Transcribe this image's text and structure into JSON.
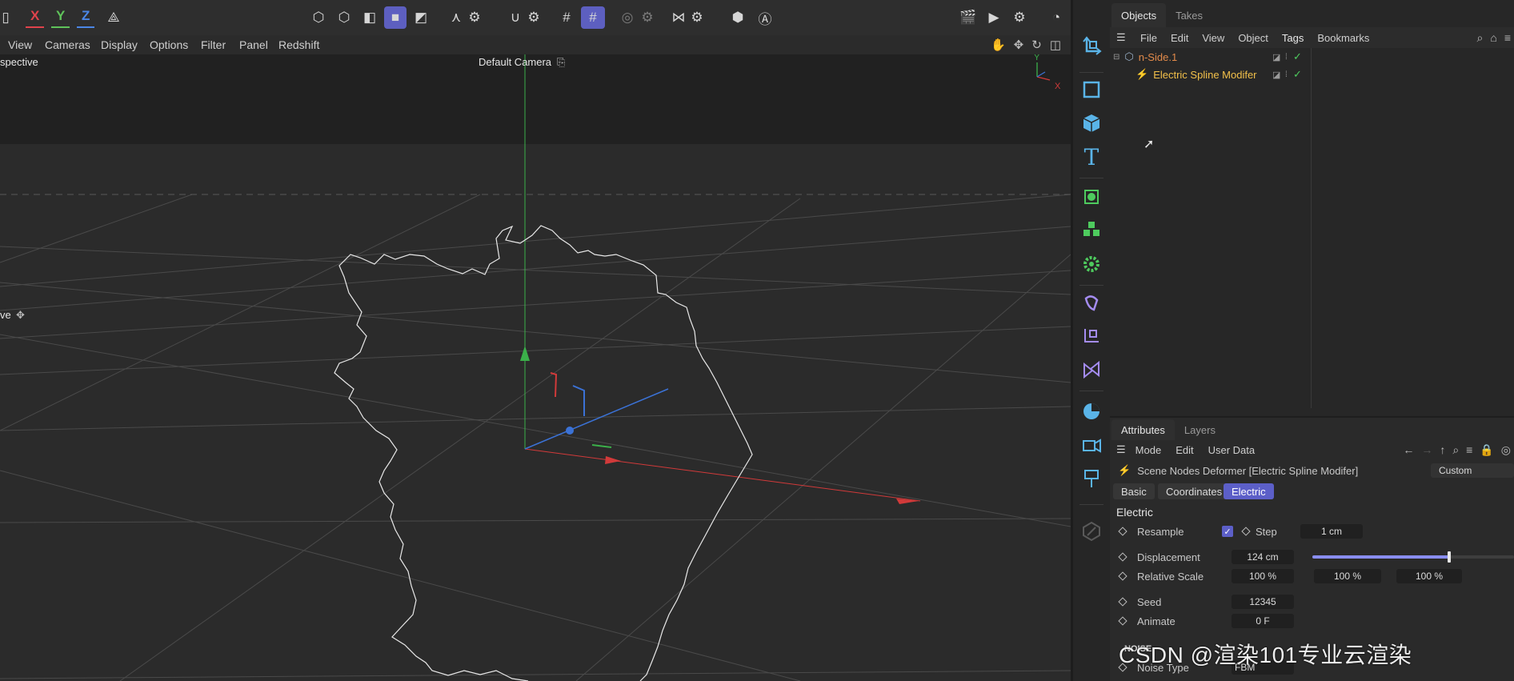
{
  "toolbar": {
    "axes": [
      {
        "label": "X",
        "color": "#e0434c"
      },
      {
        "label": "Y",
        "color": "#5fc35a"
      },
      {
        "label": "Z",
        "color": "#4b87e6"
      }
    ]
  },
  "viewport_menu": {
    "items": [
      "View",
      "Cameras",
      "Display",
      "Options",
      "Filter",
      "Panel",
      "Redshift"
    ]
  },
  "viewport": {
    "view_name": "spective",
    "camera": "Default Camera",
    "left_label": "ve",
    "axis_gizmo": {
      "y": "Y",
      "x": "X"
    }
  },
  "objects_panel": {
    "tabs": [
      "Objects",
      "Takes"
    ],
    "menu": [
      "File",
      "Edit",
      "View",
      "Object",
      "Tags",
      "Bookmarks"
    ],
    "tree": [
      {
        "name": "n-Side.1",
        "color": "#e28a4a"
      },
      {
        "name": "Electric Spline Modifer",
        "color": "#f2c04a"
      }
    ]
  },
  "attributes_panel": {
    "tabs": [
      "Attributes",
      "Layers"
    ],
    "menu": [
      "Mode",
      "Edit",
      "User Data"
    ],
    "object_title": "Scene Nodes Deformer [Electric Spline Modifer]",
    "mode_dropdown": "Custom",
    "subtabs": [
      "Basic",
      "Coordinates",
      "Electric"
    ],
    "active_subtab": "Electric",
    "section_title": "Electric",
    "resample_label": "Resample",
    "resample_checked": true,
    "step_label": "Step",
    "step_value": "1 cm",
    "displacement_label": "Displacement",
    "displacement_value": "124 cm",
    "displacement_level": 0.68,
    "relative_scale_label": "Relative Scale",
    "relative_scale_values": [
      "100 %",
      "100 %",
      "100 %"
    ],
    "seed_label": "Seed",
    "seed_value": "12345",
    "animate_label": "Animate",
    "animate_value": "0 F",
    "noise_header": "NOISE",
    "noise_type_label": "Noise Type",
    "noise_type_value": "FBM"
  },
  "watermark": "CSDN @渲染101专业云渲染",
  "colors": {
    "accent": "#5c5fc8",
    "x_axis": "#e0434c",
    "y_axis": "#4fc35a",
    "z_axis": "#3f7fe0",
    "palette_icons": "#5ab4e8",
    "green_icons": "#4ecb5e",
    "purple_icons": "#a48cf0"
  }
}
